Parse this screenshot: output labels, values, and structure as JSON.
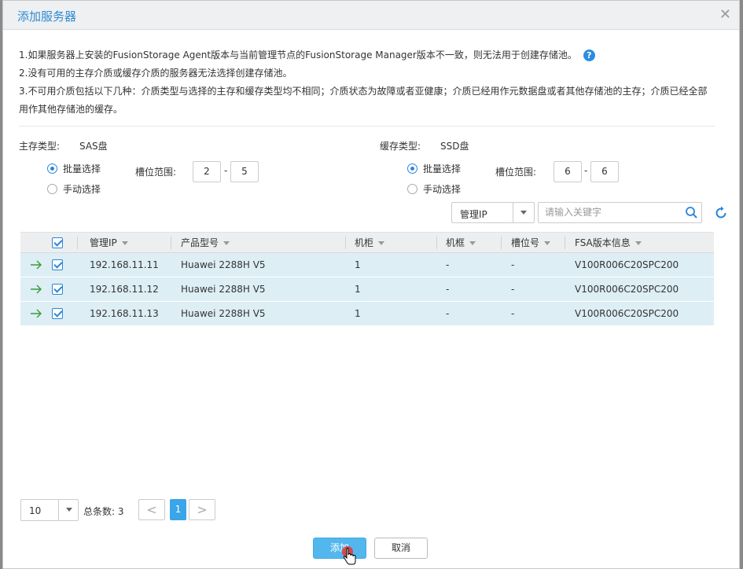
{
  "dialog": {
    "title": "添加服务器",
    "close_icon": "close-icon"
  },
  "notes": [
    "1.如果服务器上安装的FusionStorage Agent版本与当前管理节点的FusionStorage Manager版本不一致，则无法用于创建存储池。",
    "2.没有可用的主存介质或缓存介质的服务器无法选择创建存储池。",
    "3.不可用介质包括以下几种：介质类型与选择的主存和缓存类型均不相同；介质状态为故障或者亚健康；介质已经用作元数据盘或者其他存储池的主存；介质已经全部用作其他存储池的缓存。"
  ],
  "primary": {
    "label": "主存类型:",
    "value": "SAS盘",
    "batch_label": "批量选择",
    "manual_label": "手动选择",
    "slot_label": "槽位范围:",
    "slot_from": "2",
    "slot_to": "5",
    "dash": "-",
    "selected": "batch"
  },
  "cache": {
    "label": "缓存类型:",
    "value": "SSD盘",
    "batch_label": "批量选择",
    "manual_label": "手动选择",
    "slot_label": "槽位范围:",
    "slot_from": "6",
    "slot_to": "6",
    "dash": "-",
    "selected": "batch"
  },
  "filter": {
    "field_value": "管理IP",
    "search_placeholder": "请输入关键字"
  },
  "table": {
    "columns": [
      "管理IP",
      "产品型号",
      "机柜",
      "机框",
      "槽位号",
      "FSA版本信息"
    ],
    "rows": [
      [
        "192.168.11.11",
        "Huawei 2288H V5",
        "1",
        "-",
        "-",
        "V100R006C20SPC200"
      ],
      [
        "192.168.11.12",
        "Huawei 2288H V5",
        "1",
        "-",
        "-",
        "V100R006C20SPC200"
      ],
      [
        "192.168.11.13",
        "Huawei 2288H V5",
        "1",
        "-",
        "-",
        "V100R006C20SPC200"
      ]
    ]
  },
  "pager": {
    "page_size": "10",
    "total_label": "总条数: 3",
    "prev": "<",
    "next": ">",
    "current": "1"
  },
  "buttons": {
    "ok": "添加",
    "cancel": "取消"
  },
  "colors": {
    "accent": "#2b86d8",
    "row_bg": "#ddeef5",
    "ok_button": "#53b7ee",
    "title": "#2f8ad1"
  }
}
